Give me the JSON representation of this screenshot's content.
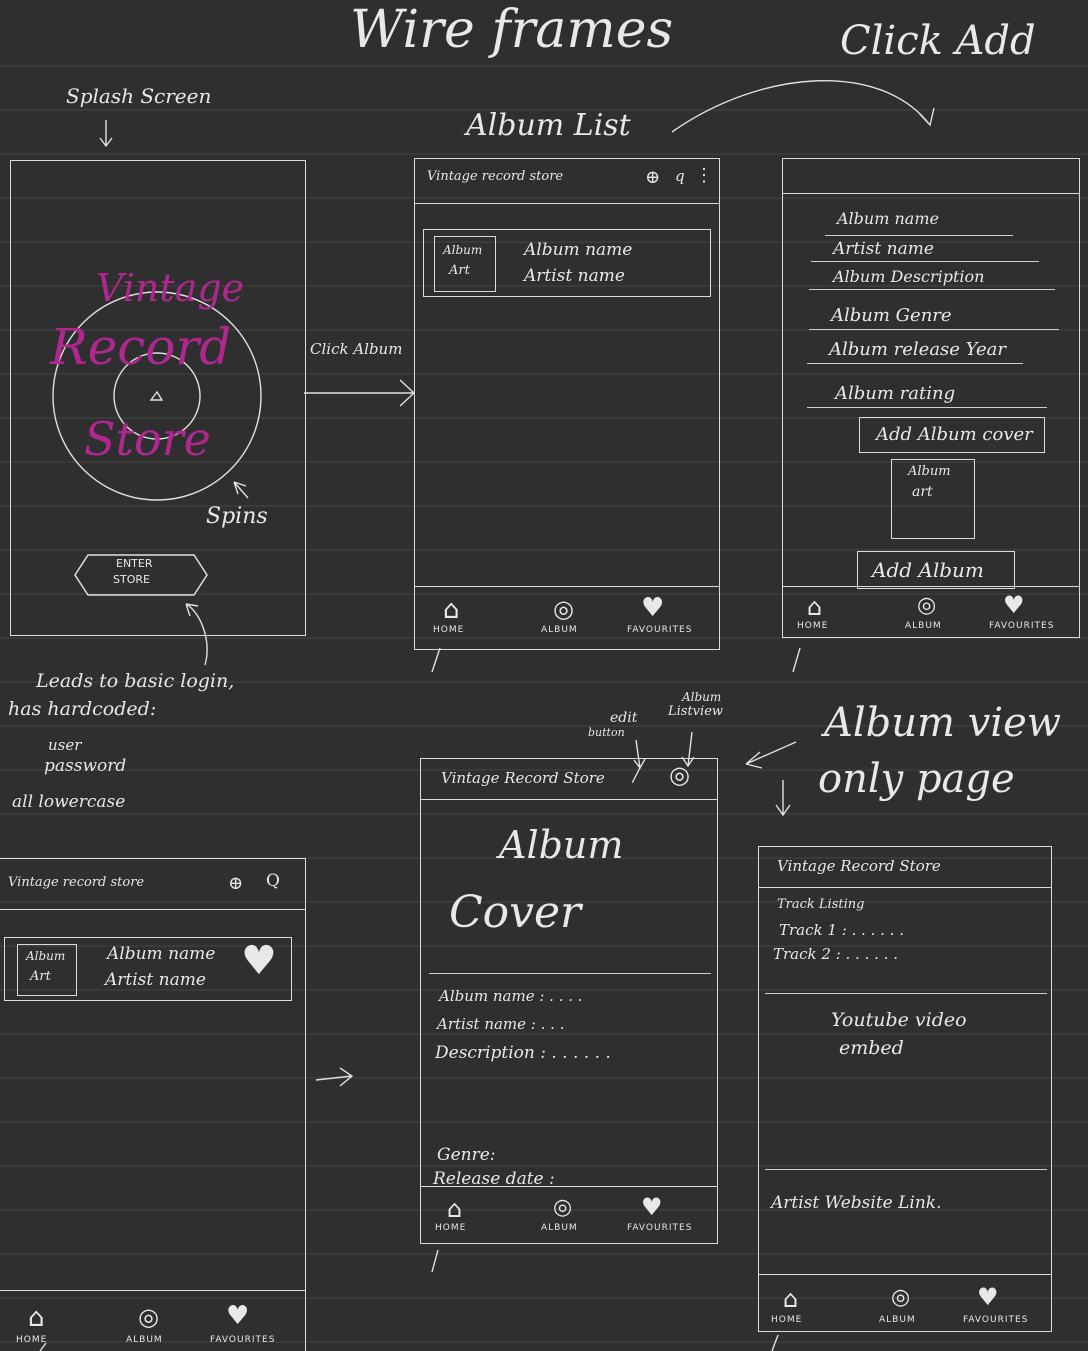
{
  "title": "Wire frames",
  "top_right": "Click Add",
  "splash": {
    "label": "Splash Screen",
    "logo": [
      "Vintage",
      "Record",
      "Store"
    ],
    "spins": "Spins",
    "enter_button": [
      "ENTER",
      "STORE"
    ],
    "note_lines": [
      "Leads to basic login,",
      "has hardcoded:",
      "user",
      "password",
      "all lowercase"
    ]
  },
  "arrow_label_album": "Click Album",
  "album_list": {
    "label": "Album List",
    "header": "Vintage record store",
    "art": [
      "Album",
      "Art"
    ],
    "album_name": "Album name",
    "artist_name": "Artist name"
  },
  "nav": {
    "home": "HOME",
    "album": "ALBUM",
    "favourites": "FAVOURITES"
  },
  "add_form": {
    "fields": [
      "Album name",
      "Artist name",
      "Album Description",
      "Album Genre",
      "Album release Year",
      "Album rating"
    ],
    "add_cover": "Add Album cover",
    "art": [
      "Album",
      "art"
    ],
    "add_album": "Add Album"
  },
  "album_view": {
    "label_line1": "Album view",
    "label_line2": "only page",
    "annot_edit": [
      "edit",
      "button"
    ],
    "annot_list": [
      "Album",
      "Listview"
    ],
    "header": "Vintage Record Store",
    "cover": [
      "Album",
      "Cover"
    ],
    "details": [
      "Album name : . . . .",
      "Artist name : . . .",
      "Description : . . . . . .",
      "Genre:",
      "Release date :"
    ]
  },
  "album_view_2": {
    "header": "Vintage Record Store",
    "track_listing": "Track Listing",
    "track1": "Track 1 : . . . . . .",
    "track2": "Track 2 : . . . . . .",
    "youtube": [
      "Youtube video",
      "embed"
    ],
    "artist_link": "Artist Website Link."
  },
  "favourites_list": {
    "header": "Vintage record store",
    "art": [
      "Album",
      "Art"
    ],
    "album_name": "Album name",
    "artist_name": "Artist name"
  }
}
